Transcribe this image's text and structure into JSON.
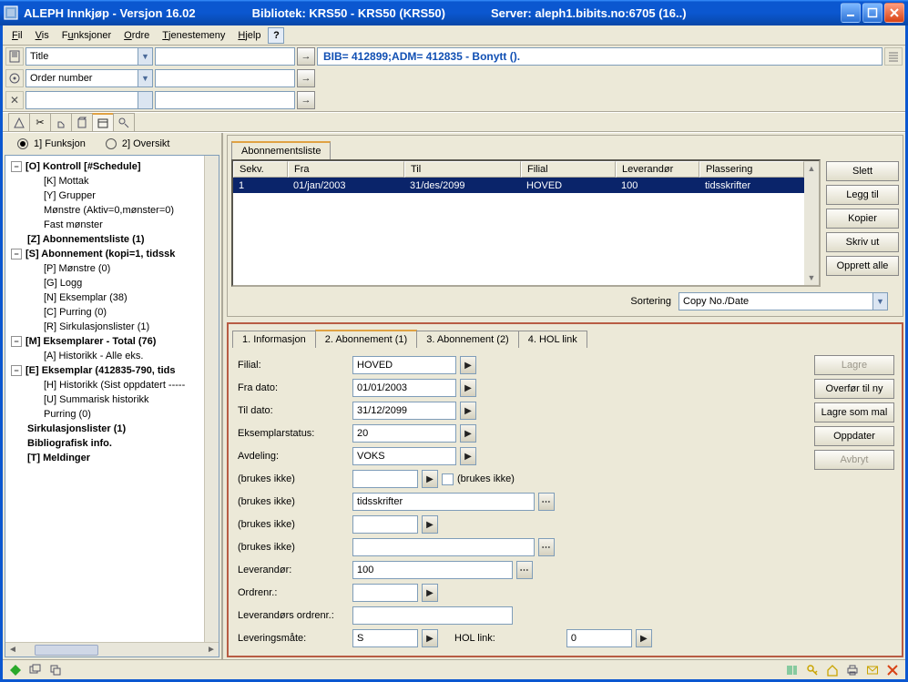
{
  "titlebar": {
    "program": "ALEPH Innkjøp - Versjon 16.02",
    "library": "Bibliotek:  KRS50 - KRS50 (KRS50)",
    "server": "Server:  aleph1.bibits.no:6705 (16..)"
  },
  "menubar": {
    "fil": "Fil",
    "vis": "Vis",
    "funk": "Funksjoner",
    "ordre": "Ordre",
    "tj": "Tjenestemeny",
    "hjelp": "Hjelp"
  },
  "toolbar": {
    "sel1": "Title",
    "sel2": "Order number",
    "recline": "BIB= 412899;ADM= 412835 - Bonytt ()."
  },
  "leftpanel": {
    "radios": {
      "r1": "1] Funksjon",
      "r2": "2] Oversikt"
    },
    "tree": {
      "n0": "[O] Kontroll [#Schedule]",
      "n0a": "[K] Mottak",
      "n0b": "[Y] Grupper",
      "n0c": "Mønstre (Aktiv=0,mønster=0)",
      "n0d": "Fast mønster",
      "n1": "[Z] Abonnementsliste (1)",
      "n2": "[S] Abonnement (kopi=1, tidssk",
      "n2a": "[P] Mønstre (0)",
      "n2b": "[G] Logg",
      "n2c": "[N] Eksemplar (38)",
      "n2d": "[C] Purring (0)",
      "n2e": "[R] Sirkulasjonslister (1)",
      "n3": "[M] Eksemplarer - Total (76)",
      "n3a": "[A] Historikk - Alle eks.",
      "n4": "[E] Eksemplar (412835-790, tids",
      "n4a": "[H] Historikk (Sist oppdatert -----",
      "n4b": "[U] Summarisk historikk",
      "n4c": "Purring (0)",
      "n5": "Sirkulasjonslister (1)",
      "n6": "Bibliografisk info.",
      "n7": "[T] Meldinger"
    }
  },
  "upper": {
    "tab": "Abonnementsliste",
    "head": {
      "c1": "Sekv.",
      "c2": "Fra",
      "c3": "Til",
      "c4": "Filial",
      "c5": "Leverandør",
      "c6": "Plassering"
    },
    "row": {
      "c1": "1",
      "c2": "01/jan/2003",
      "c3": "31/des/2099",
      "c4": "HOVED",
      "c5": "100",
      "c6": "tidsskrifter"
    },
    "btns": {
      "b1": "Slett",
      "b2": "Legg til",
      "b3": "Kopier",
      "b4": "Skriv ut",
      "b5": "Opprett alle"
    },
    "sort_label": "Sortering",
    "sort_value": "Copy No./Date"
  },
  "form": {
    "tabs": {
      "t1": "1. Informasjon",
      "t2": "2. Abonnement (1)",
      "t3": "3. Abonnement (2)",
      "t4": "4. HOL link"
    },
    "rows": {
      "filial_l": "Filial:",
      "filial_v": "HOVED",
      "fra_l": "Fra dato:",
      "fra_v": "01/01/2003",
      "til_l": "Til dato:",
      "til_v": "31/12/2099",
      "eks_l": "Eksemplarstatus:",
      "eks_v": "20",
      "avd_l": "Avdeling:",
      "avd_v": "VOKS",
      "bi1_l": "(brukes ikke)",
      "bi1_v": "",
      "bi1_chk": "(brukes ikke)",
      "bi2_l": "(brukes ikke)",
      "bi2_v": "tidsskrifter",
      "bi3_l": "(brukes ikke)",
      "bi3_v": "",
      "bi4_l": "(brukes ikke)",
      "bi4_v": "",
      "lev_l": "Leverandør:",
      "lev_v": "100",
      "ord_l": "Ordrenr.:",
      "ord_v": "",
      "lo_l": "Leverandørs ordrenr.:",
      "lo_v": "",
      "lm_l": "Leveringsmåte:",
      "lm_v": "S",
      "hol_l": "HOL link:",
      "hol_v": "0"
    },
    "btns": {
      "b1": "Lagre",
      "b2": "Overfør til ny",
      "b3": "Lagre som mal",
      "b4": "Oppdater",
      "b5": "Avbryt"
    }
  }
}
